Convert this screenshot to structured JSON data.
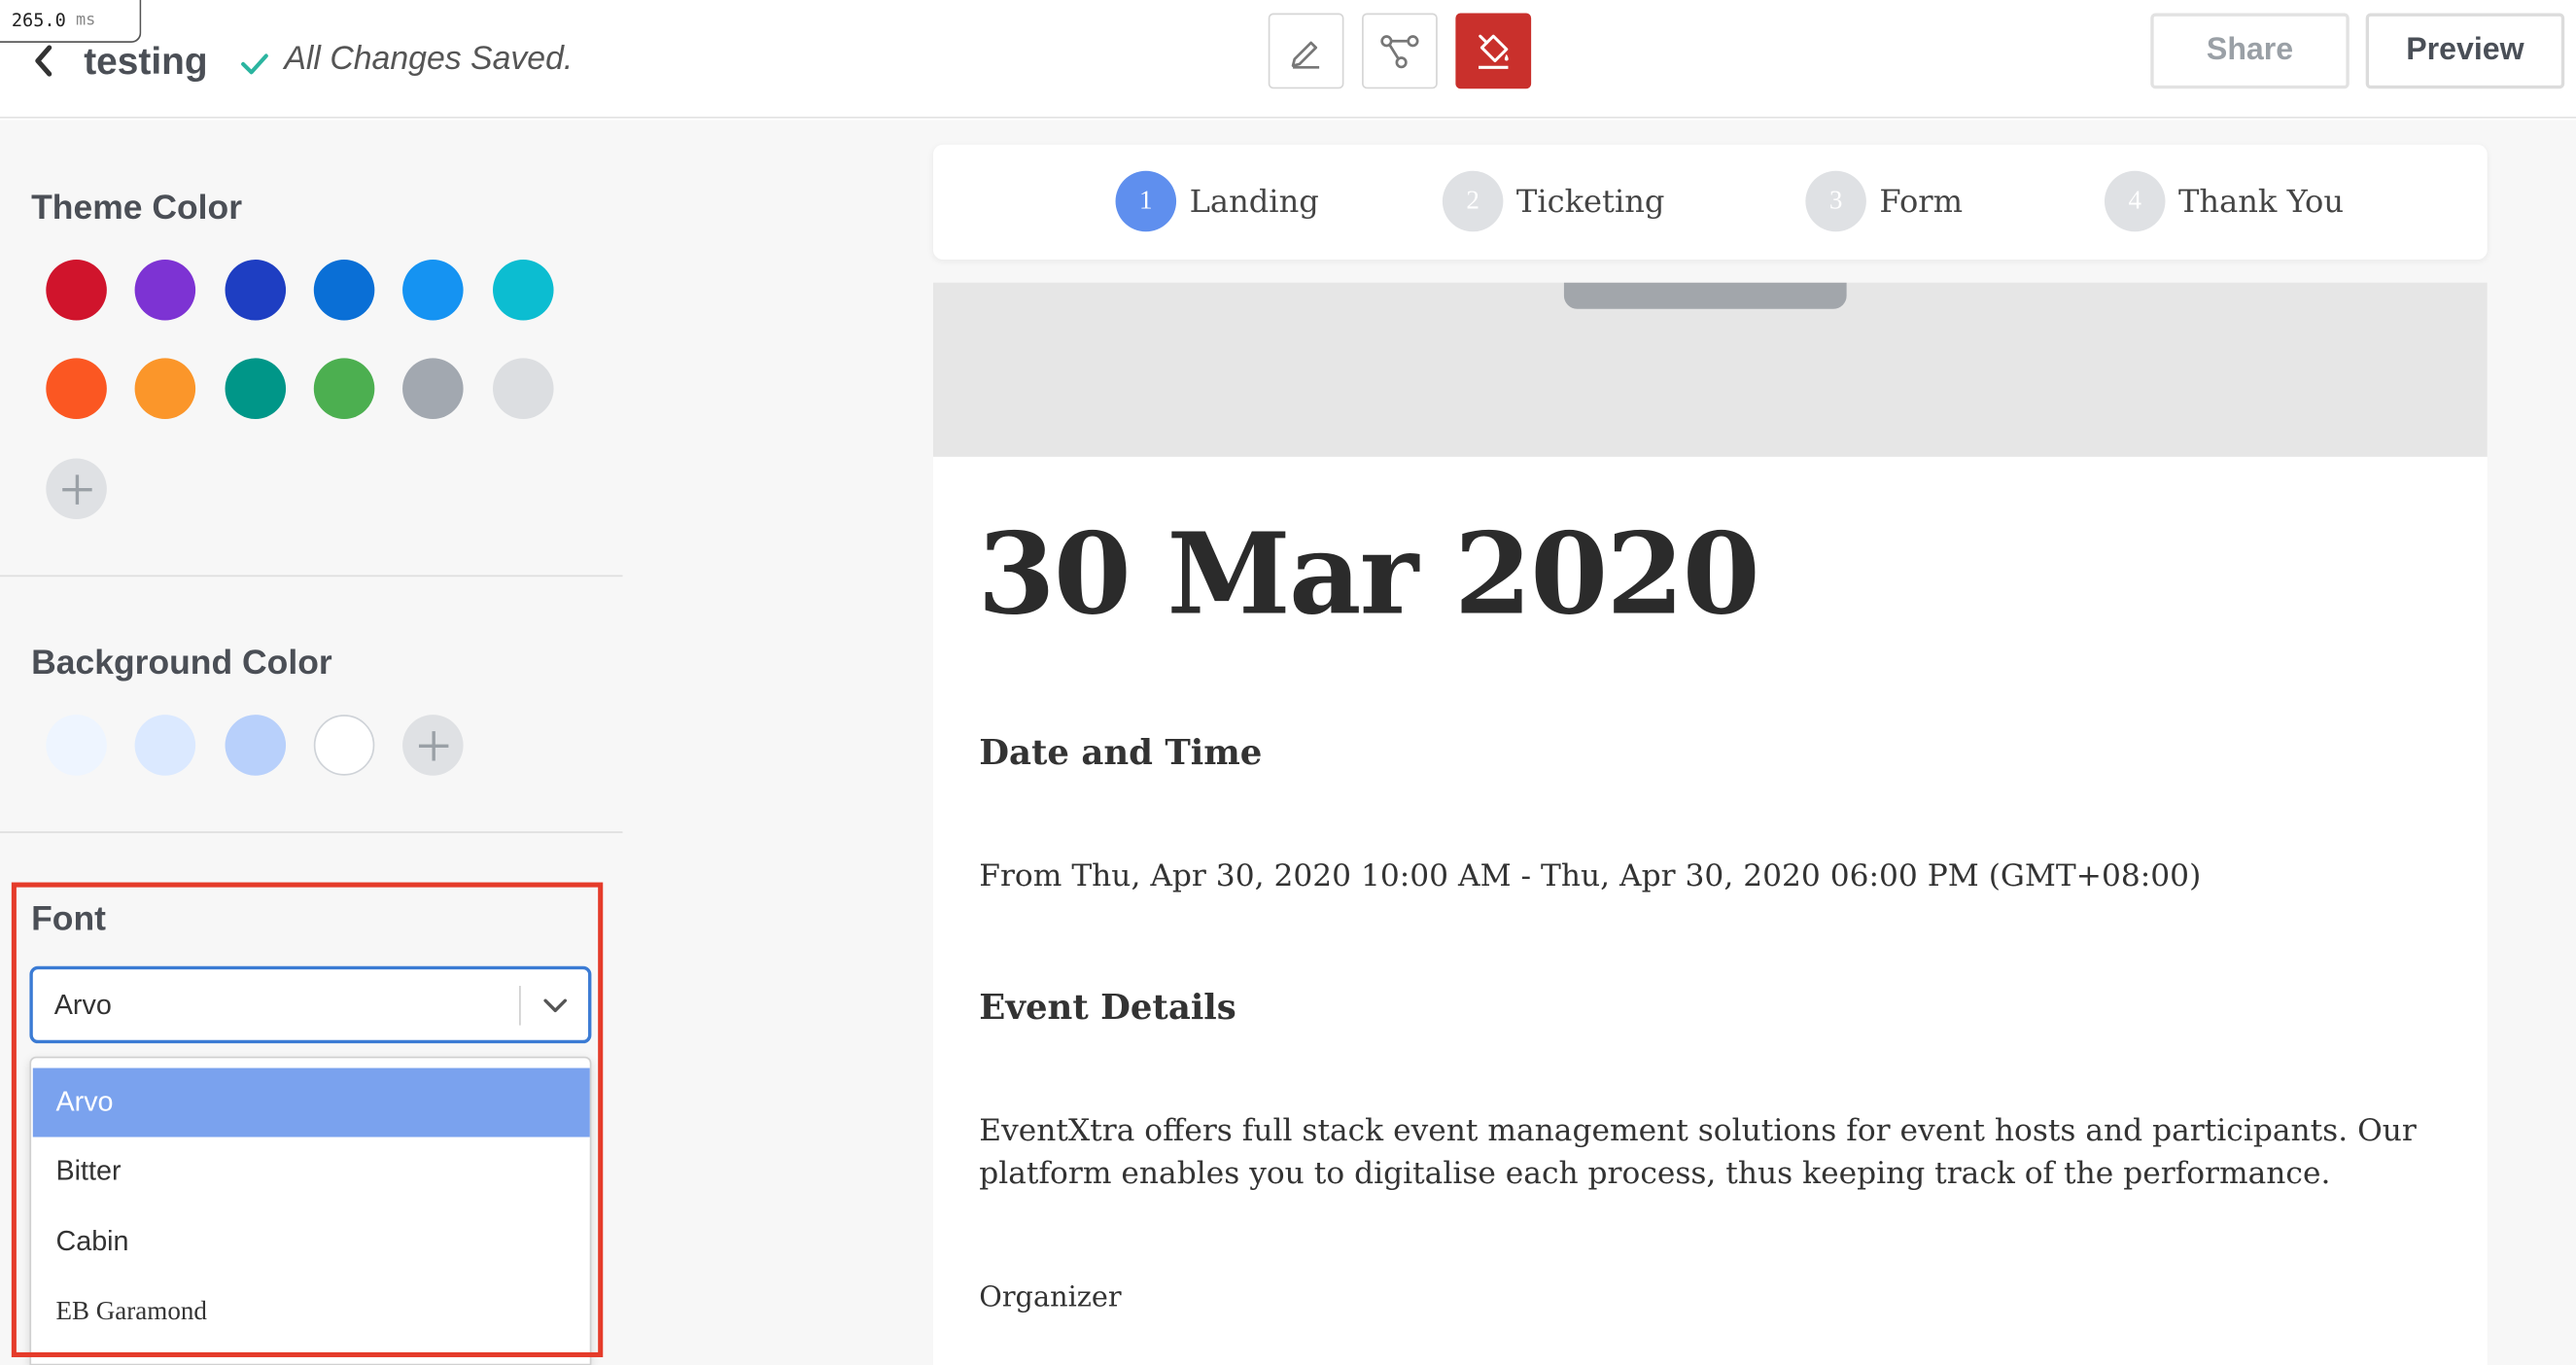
{
  "perf": {
    "value": "265.0",
    "unit": "ms"
  },
  "header": {
    "title": "testing",
    "saved_status": "All Changes Saved.",
    "share_label": "Share",
    "preview_label": "Preview",
    "tools": [
      {
        "icon": "pencil-icon"
      },
      {
        "icon": "flow-icon"
      },
      {
        "icon": "paint-bucket-icon",
        "active": true
      }
    ]
  },
  "sidebar": {
    "theme_color": {
      "title": "Theme Color",
      "colors": [
        "#d0142c",
        "#7d33d3",
        "#1e3ec2",
        "#0a6fd6",
        "#1593f2",
        "#0cbdd1",
        "#fb5722",
        "#fb962a",
        "#009688",
        "#4caf50",
        "#a2a8b0",
        "#dcdee1"
      ]
    },
    "background_color": {
      "title": "Background Color",
      "colors": [
        "#eef5ff",
        "#dbe9ff",
        "#b8d0fb",
        "#ffffff"
      ]
    },
    "font": {
      "title": "Font",
      "selected": "Arvo",
      "options": [
        "Arvo",
        "Bitter",
        "Cabin",
        "EB Garamond"
      ]
    }
  },
  "steps": [
    {
      "num": "1",
      "label": "Landing",
      "active": true
    },
    {
      "num": "2",
      "label": "Ticketing",
      "active": false
    },
    {
      "num": "3",
      "label": "Form",
      "active": false
    },
    {
      "num": "4",
      "label": "Thank You",
      "active": false
    }
  ],
  "event": {
    "date_title": "30 Mar 2020",
    "date_time_heading": "Date and Time",
    "date_time_value": "From Thu, Apr 30, 2020 10:00 AM - Thu, Apr 30, 2020 06:00 PM (GMT+08:00)",
    "details_heading": "Event Details",
    "details_text": "EventXtra offers full stack event management solutions for event hosts and participants. Our platform enables you to digitalise each process, thus keeping track of the performance.",
    "organizer_label": "Organizer"
  },
  "colors": {
    "accent_blue": "#3b7bd4",
    "step_active": "#5f8fee",
    "highlight_red": "#e53b2a",
    "tool_active": "#c9302c",
    "saved_check": "#2bb5a0"
  }
}
